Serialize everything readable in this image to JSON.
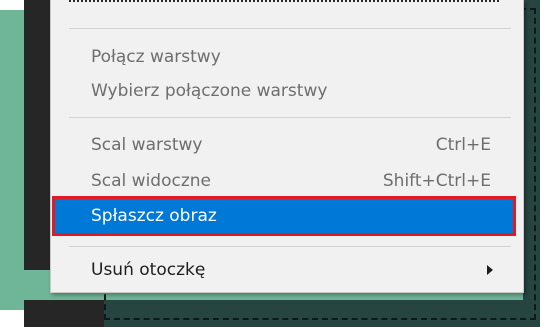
{
  "menu": {
    "items": [
      {
        "label": "Połącz warstwy",
        "shortcut": ""
      },
      {
        "label": "Wybierz połączone warstwy",
        "shortcut": ""
      },
      {
        "label": "Scal warstwy",
        "shortcut": "Ctrl+E"
      },
      {
        "label": "Scal widoczne",
        "shortcut": "Shift+Ctrl+E"
      },
      {
        "label": "Spłaszcz obraz",
        "shortcut": ""
      },
      {
        "label": "Usuń otoczkę",
        "shortcut": ""
      }
    ],
    "highlight_color": "#0078d7",
    "annotation_color": "#e01b24"
  }
}
